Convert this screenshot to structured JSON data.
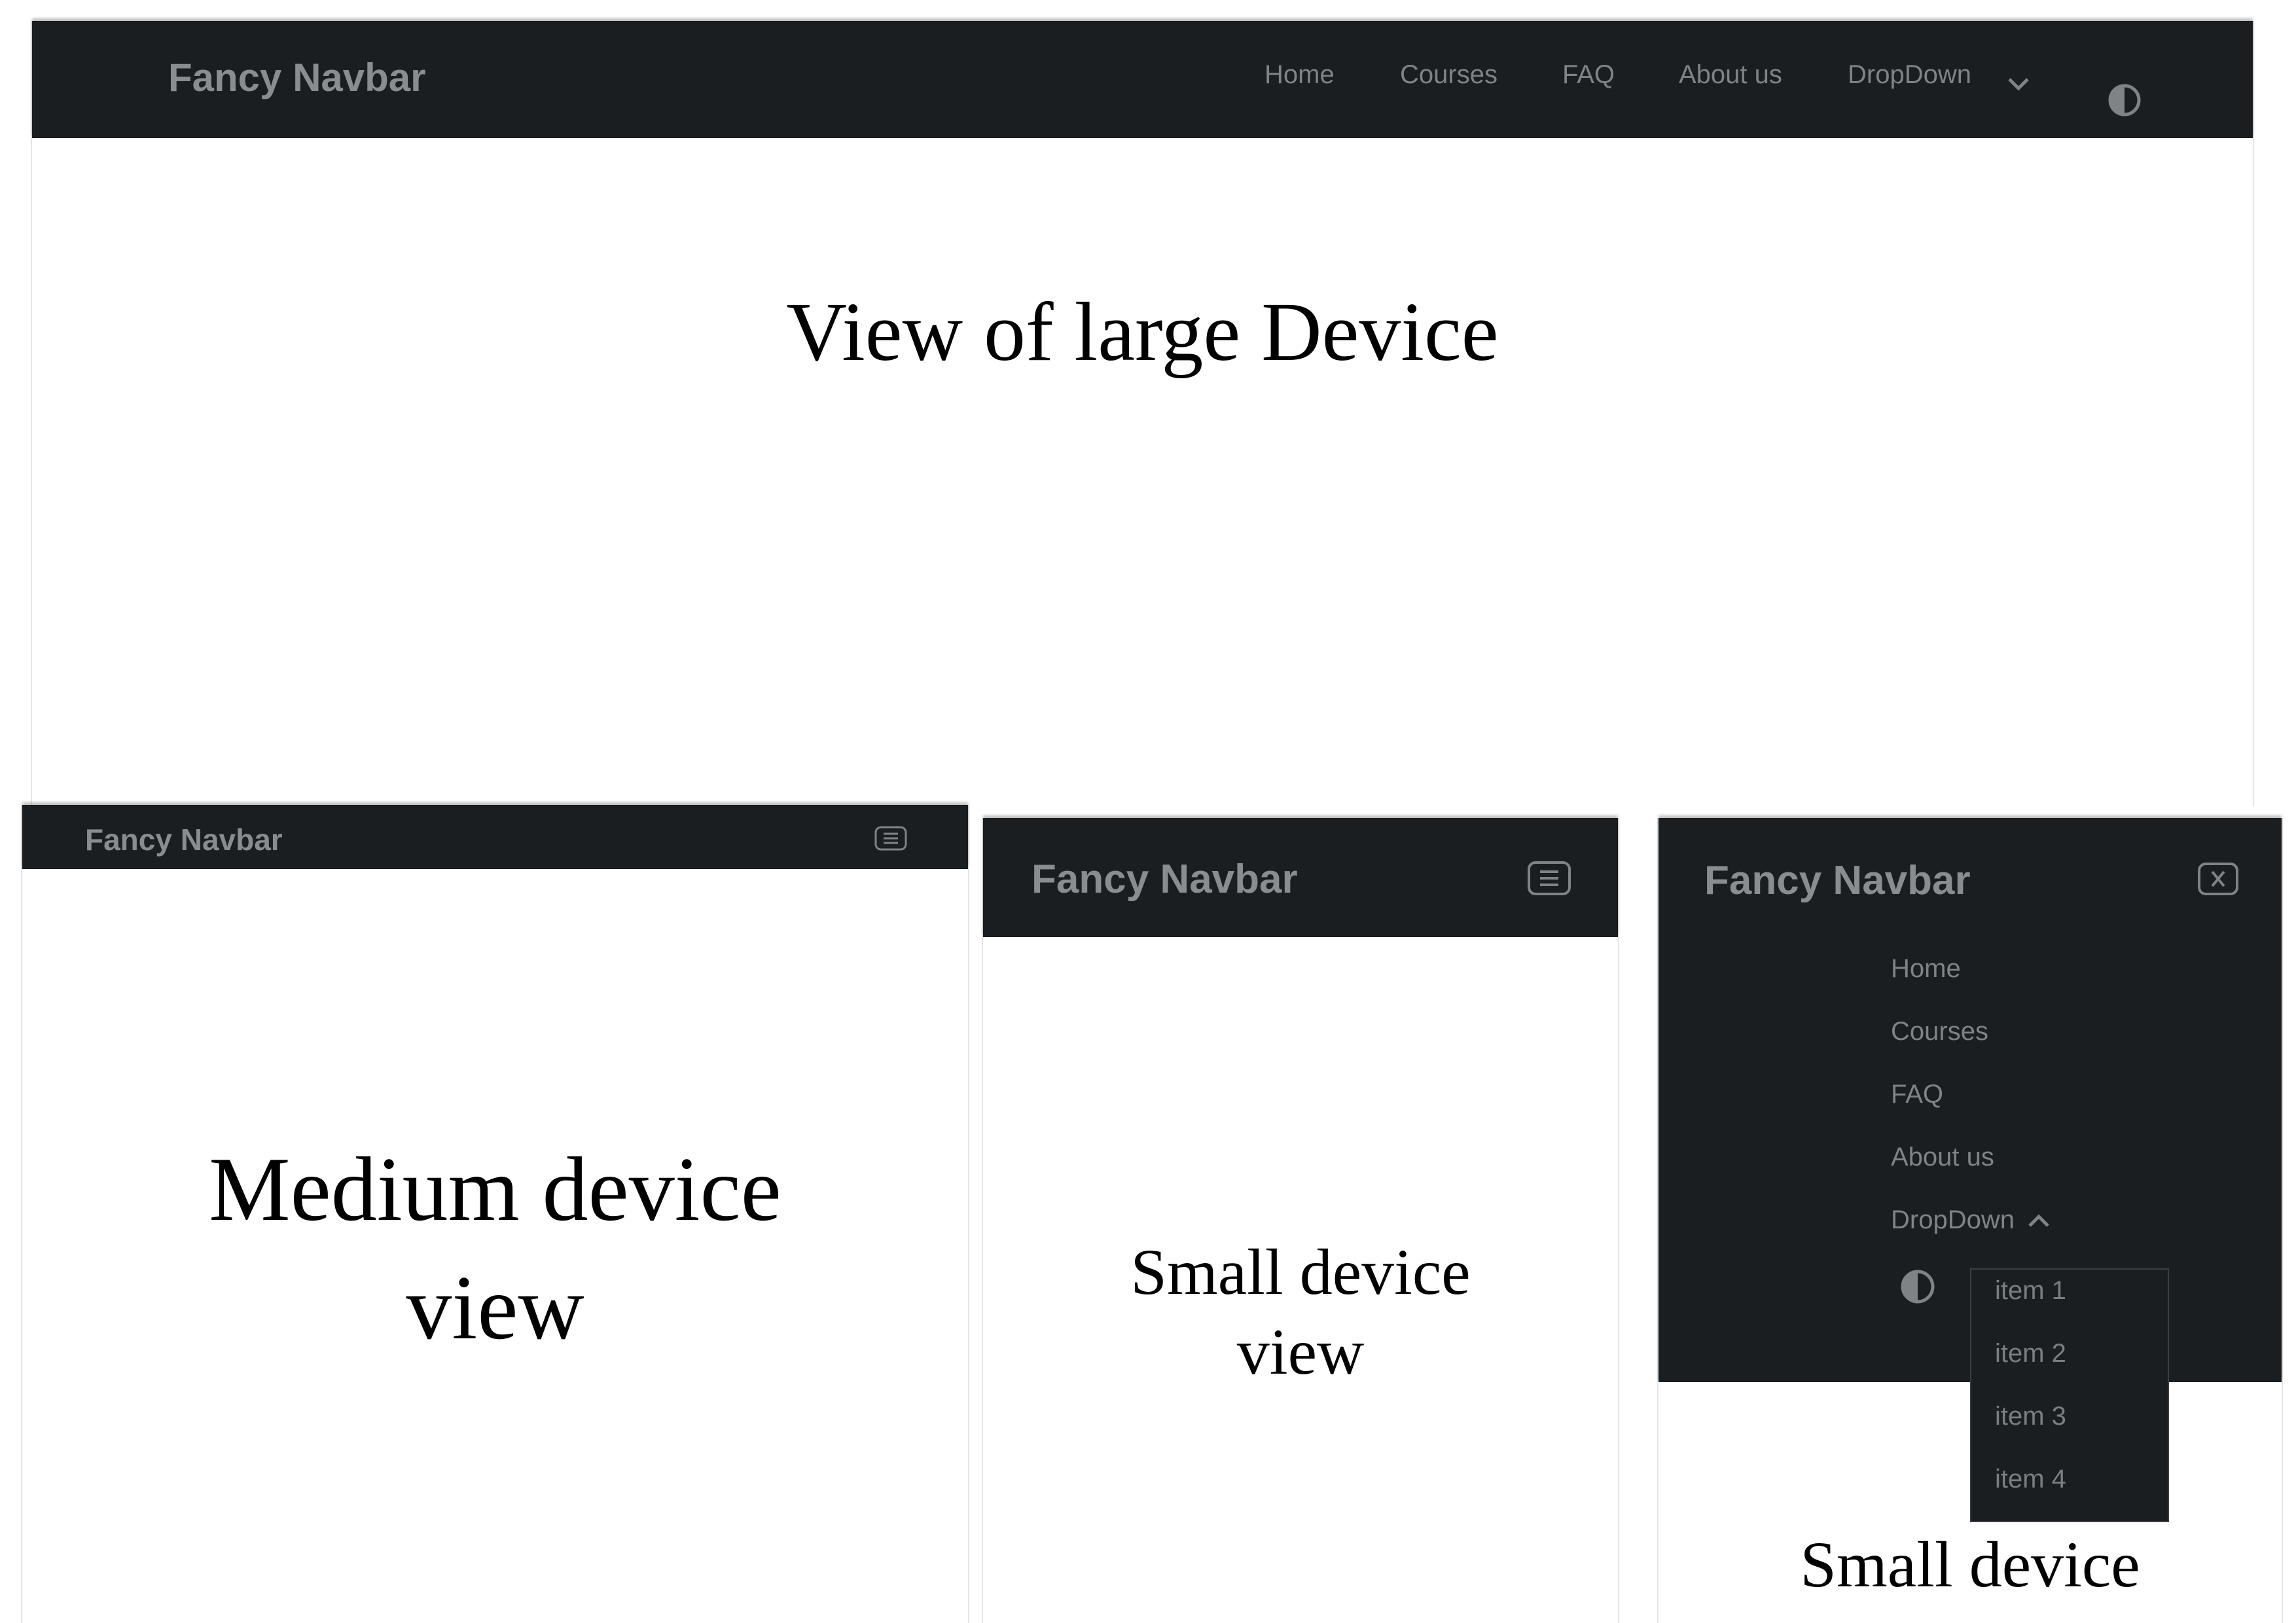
{
  "colors": {
    "navbar_bg": "#1b1e21",
    "nav_text": "#7f8386",
    "brand_text": "#8a8d90",
    "page_bg": "#ffffff"
  },
  "large": {
    "brand": "Fancy Navbar",
    "links": [
      "Home",
      "Courses",
      "FAQ",
      "About us",
      "DropDown"
    ],
    "icons": {
      "dropdown": "chevron-down-icon",
      "theme": "contrast-icon"
    },
    "caption": "View of large Device"
  },
  "medium": {
    "brand": "Fancy Navbar",
    "icons": {
      "menu": "menu-icon"
    },
    "caption_line1": "Medium device",
    "caption_line2": "view"
  },
  "small": {
    "brand": "Fancy Navbar",
    "icons": {
      "menu": "menu-icon"
    },
    "caption_line1": "Small device",
    "caption_line2": "view"
  },
  "small_open": {
    "brand": "Fancy Navbar",
    "links": [
      "Home",
      "Courses",
      "FAQ",
      "About us",
      "DropDown"
    ],
    "dropdown_items": [
      "item 1",
      "item 2",
      "item 3",
      "item 4"
    ],
    "icons": {
      "close": "close-icon",
      "dropdown": "chevron-up-icon",
      "theme": "contrast-icon"
    },
    "caption": "Small device"
  }
}
